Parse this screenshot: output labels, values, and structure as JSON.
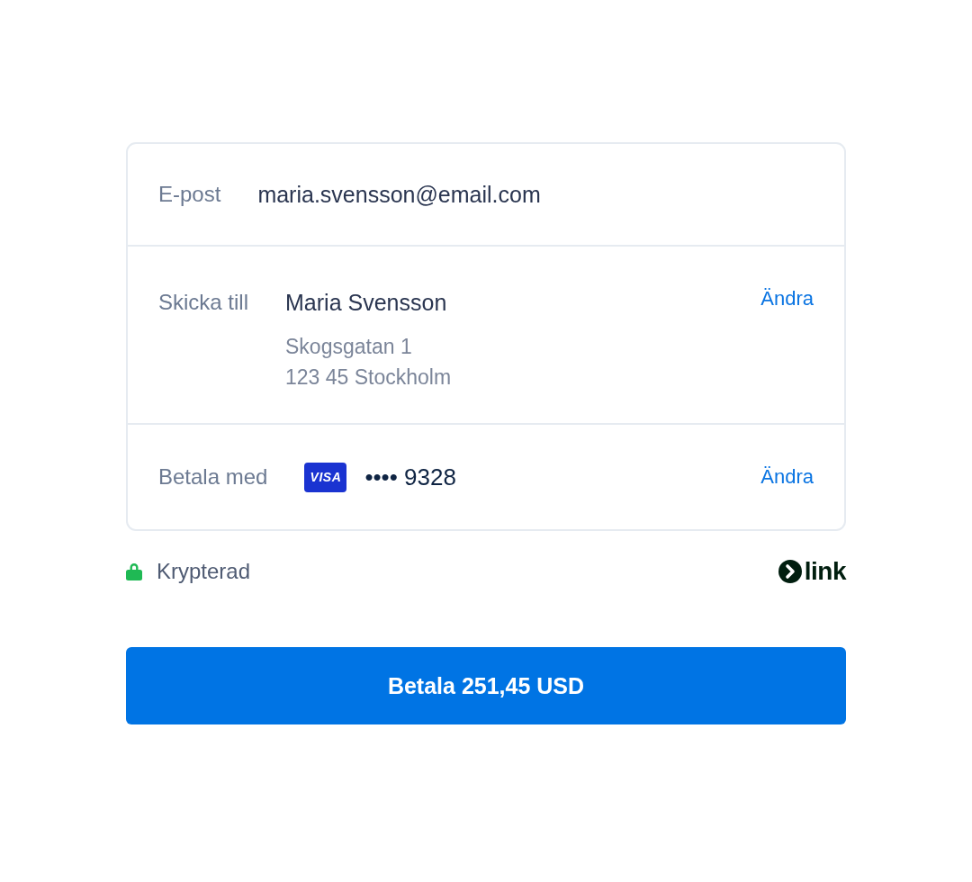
{
  "card": {
    "rows": [
      {
        "kind": "email",
        "label": "E-post",
        "value": "maria.svensson@email.com"
      },
      {
        "kind": "address",
        "label": "Skicka till",
        "name": "Maria Svensson",
        "lines": [
          "Skogsgatan 1",
          "123 45 Stockholm"
        ],
        "action": "Ändra"
      },
      {
        "kind": "payment",
        "label": "Betala med",
        "card_brand": "VISA",
        "masked_number": "•••• 9328",
        "action": "Ändra"
      }
    ]
  },
  "security": {
    "label": "Krypterad"
  },
  "brand": {
    "name": "link"
  },
  "pay_button": {
    "label": "Betala 251,45 USD"
  }
}
